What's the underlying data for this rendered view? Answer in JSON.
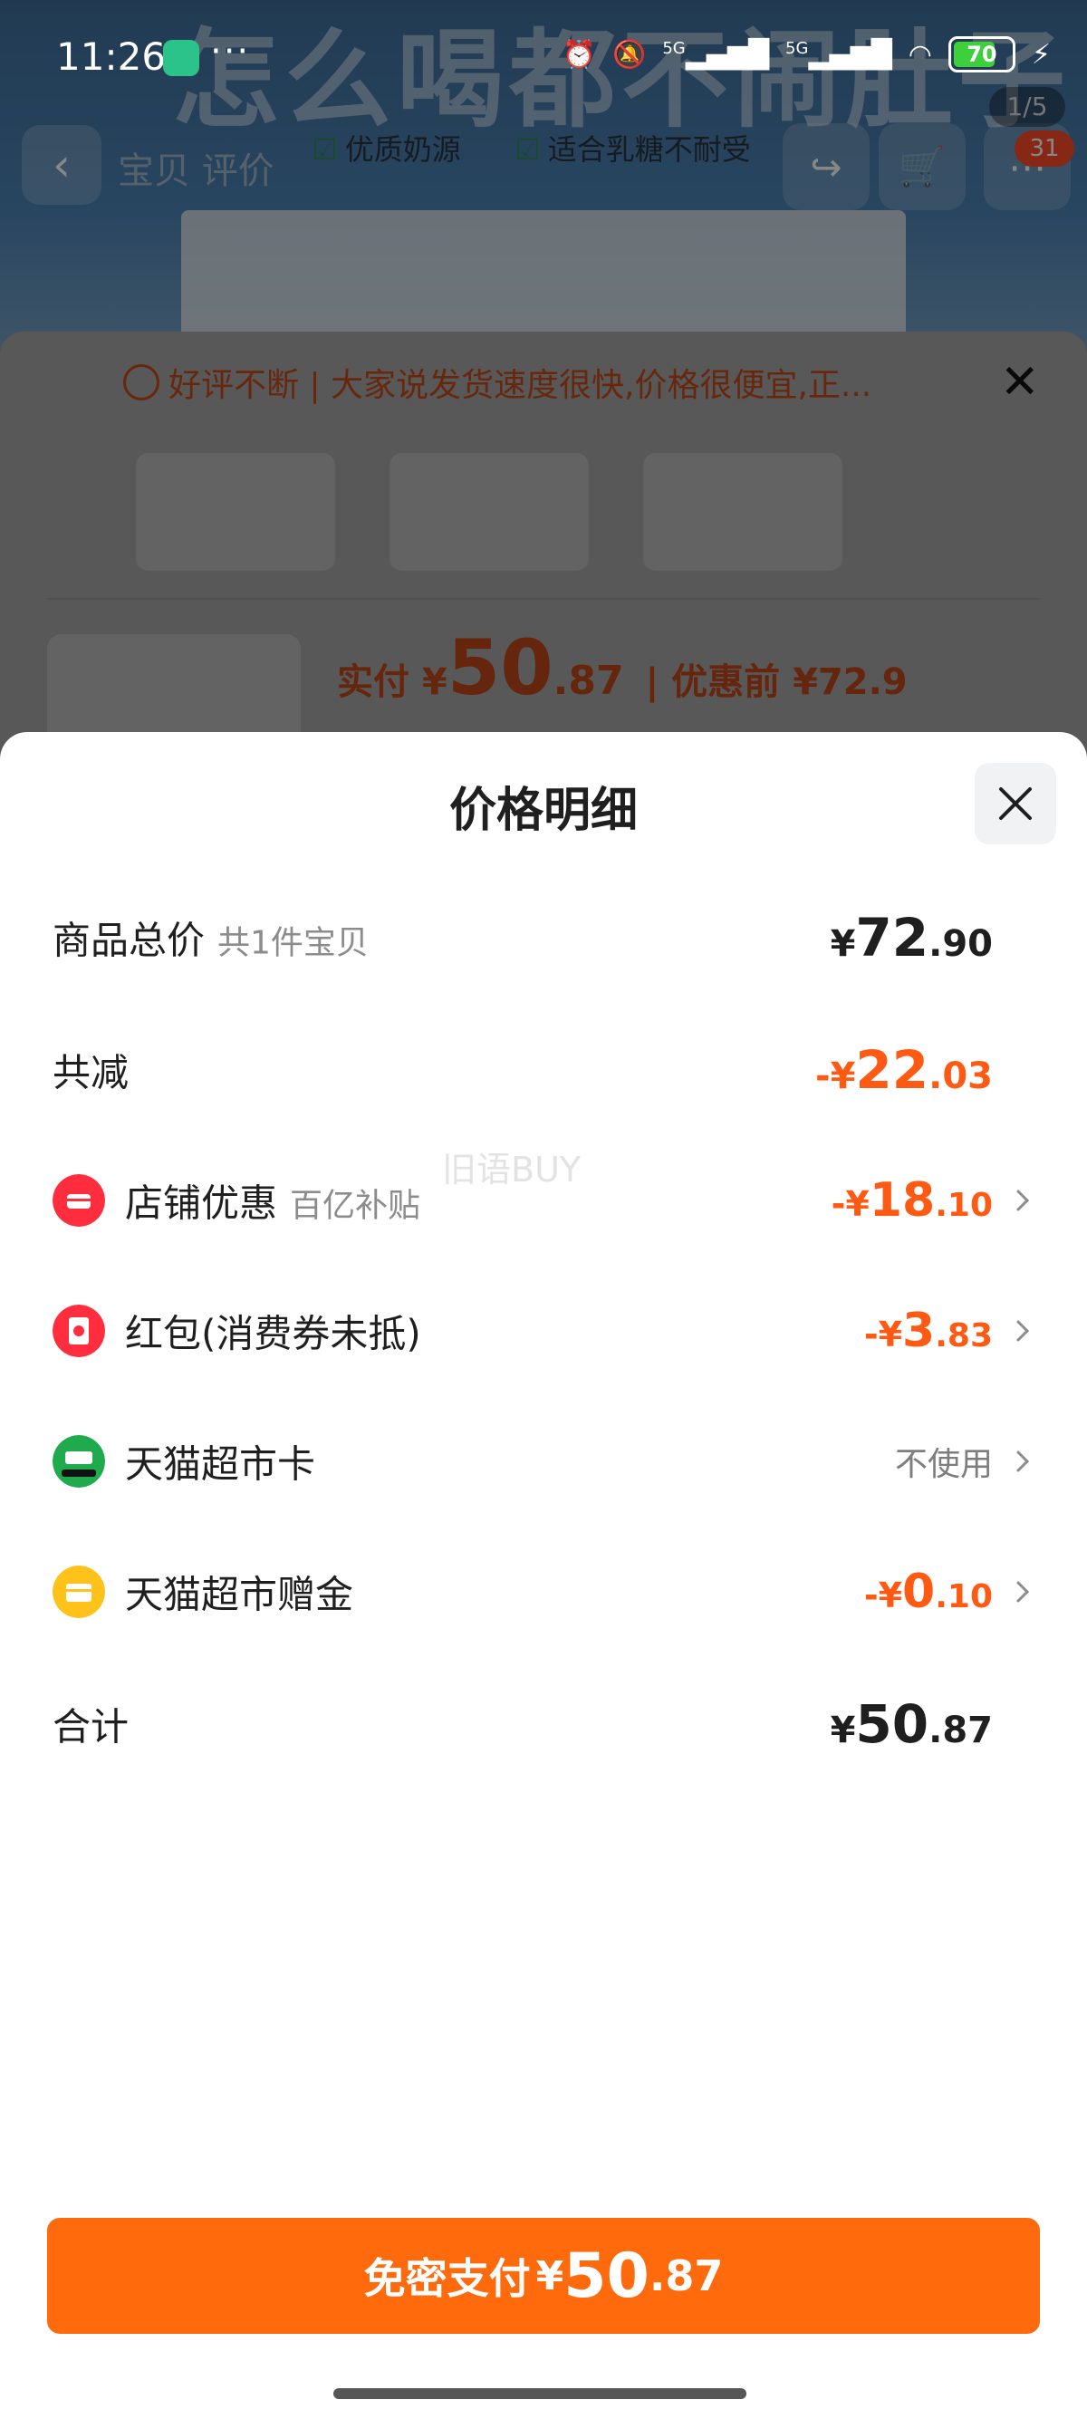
{
  "status_bar": {
    "time": "11:26",
    "app_badge_color": "#2bc38a",
    "dots": "···",
    "network_1": "5G",
    "network_2": "5G",
    "battery": "70"
  },
  "background_page": {
    "banner_text": "怎么喝都不闹肚子",
    "nav_tabs": "宝贝  评价",
    "features": [
      "优质奶源",
      "适合乳糖不耐受"
    ],
    "image_counter": "1/5",
    "cart_badge": "31",
    "tip_text": "好评不断 | 大家说发货速度很快,价格很便宜,正...",
    "price_label": "实付 ¥",
    "price_int": "50",
    "price_dec": ".87",
    "price_before": "| 优惠前 ¥72.9"
  },
  "sheet": {
    "title": "价格明细",
    "watermark": "旧语BUY",
    "rows": [
      {
        "label": "商品总价",
        "sub": "共1件宝贝",
        "yen": "¥",
        "int": "72",
        "dec": ".90"
      },
      {
        "label": "共减",
        "yen": "-¥",
        "int": "22",
        "dec": ".03"
      },
      {
        "label": "店铺优惠",
        "sub": "百亿补贴",
        "yen": "-¥",
        "int": "18",
        "dec": ".10",
        "icon": "shop-icon"
      },
      {
        "label": "红包(消费券未抵)",
        "yen": "-¥",
        "int": "3",
        "dec": ".83",
        "icon": "red-packet-icon"
      },
      {
        "label": "天猫超市卡",
        "value_text": "不使用",
        "icon": "tmall-card-icon"
      },
      {
        "label": "天猫超市赠金",
        "yen": "-¥",
        "int": "0",
        "dec": ".10",
        "icon": "gift-money-icon"
      },
      {
        "label": "合计",
        "yen": "¥",
        "int": "50",
        "dec": ".87"
      }
    ],
    "pay_button": {
      "label": "免密支付",
      "yen": "¥",
      "int": "50",
      "dec": ".87"
    }
  },
  "colors": {
    "accent_orange": "#ff6a0d",
    "discount_orange": "#ff5a14",
    "text_dark": "#1f1f1f",
    "text_gray": "#8c8c8c"
  }
}
